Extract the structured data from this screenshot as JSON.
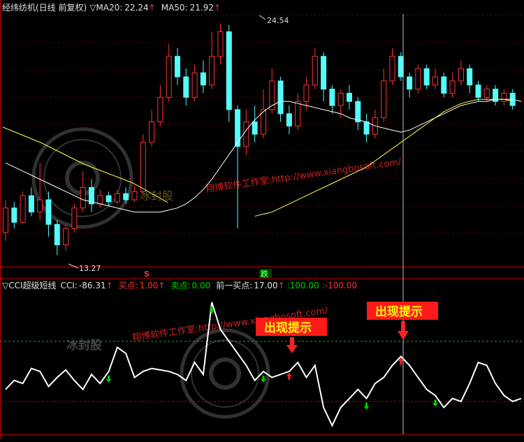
{
  "header": {
    "title": "经纬纺机(日线 前复权)",
    "ma20_label": "MA20:",
    "ma20_value": "22.24",
    "ma50_label": "MA50:",
    "ma50_value": "21.92"
  },
  "indicator_header": {
    "name": "CCI超级短线",
    "cci_label": "CCI:",
    "cci_value": "-86.31",
    "buy_label": "买点:",
    "buy_value": "1.00",
    "sell_label": "卖点:",
    "sell_value": "0.00",
    "prev_buy_label": "前一买点:",
    "prev_buy_value": "17.00",
    "upper_value": ":100.00",
    "lower_value": ":-100.00"
  },
  "price_labels": {
    "high": "24.54",
    "low": "13.27"
  },
  "axis_markers": {
    "s_marker": "S",
    "die_marker": "跌"
  },
  "annotations": {
    "tip1": "出现提示",
    "tip2": "出现提示"
  },
  "watermarks": {
    "studio_top": "翔博软件工作室:http://www.xiangbosoft.com/",
    "studio_bottom": "翔博软件工作室:http://www.xiangbosoft.com/",
    "brand_top": "冰封股",
    "brand_bottom": "冰封股"
  },
  "colors": {
    "up": "#ff3232",
    "down": "#54fcfc",
    "ma20": "#ffffff",
    "ma50": "#ffff50",
    "cci": "#ffffff",
    "level_upper": "#00c000",
    "level_lower": "#c00000",
    "buy_arrow": "#ff2020",
    "sell_arrow": "#00d000",
    "tip_bg": "#ff1a1a",
    "tip_text": "#ffff00"
  },
  "chart_data": [
    {
      "type": "candlestick",
      "ylim": [
        12.8,
        25.0
      ],
      "series": [
        {
          "name": "MA20",
          "values": [
            17.8,
            17.6,
            17.4,
            17.2,
            17.0,
            16.8,
            16.6,
            16.4,
            16.2,
            16.0,
            15.9,
            15.8,
            15.7,
            15.6,
            15.5,
            15.4,
            15.4,
            15.4,
            15.4,
            15.5,
            15.6,
            15.8,
            16.1,
            16.5,
            17.0,
            17.6,
            18.2,
            18.8,
            19.4,
            19.9,
            20.3,
            20.6,
            20.8,
            20.8,
            20.7,
            20.6,
            20.5,
            20.4,
            20.3,
            20.2,
            20.0,
            19.9,
            19.8,
            19.6,
            19.5,
            19.4,
            19.3,
            19.4,
            19.6,
            19.8,
            20.0,
            20.2,
            20.4,
            20.6,
            20.7,
            20.8,
            20.8,
            20.9,
            20.9,
            20.9,
            20.8
          ]
        },
        {
          "name": "MA50",
          "values": [
            15.2,
            15.3,
            15.4,
            15.6,
            15.8,
            16.0,
            16.2,
            16.4,
            16.6,
            16.8,
            17.0,
            17.2,
            17.4,
            17.6,
            17.9,
            18.2,
            18.5,
            18.8,
            19.1,
            19.4,
            19.7,
            20.0,
            20.3,
            20.5,
            20.7,
            20.8,
            20.9,
            20.9,
            20.9,
            20.9,
            20.8
          ]
        }
      ],
      "candles": [
        [
          14.4,
          15.6,
          16.0,
          14.0
        ],
        [
          15.6,
          14.9,
          15.9,
          14.6
        ],
        [
          14.9,
          16.2,
          16.4,
          14.8
        ],
        [
          16.2,
          15.4,
          16.6,
          15.2
        ],
        [
          15.4,
          16.0,
          17.8,
          15.0
        ],
        [
          16.0,
          14.8,
          16.4,
          14.2
        ],
        [
          14.8,
          13.8,
          15.0,
          13.3
        ],
        [
          13.8,
          14.6,
          14.8,
          13.5
        ],
        [
          14.6,
          15.6,
          15.8,
          14.4
        ],
        [
          15.6,
          16.6,
          17.4,
          15.4
        ],
        [
          16.6,
          15.8,
          17.0,
          15.4
        ],
        [
          15.8,
          16.2,
          16.5,
          15.6
        ],
        [
          16.2,
          15.9,
          16.4,
          15.7
        ],
        [
          15.9,
          16.3,
          16.5,
          15.8
        ],
        [
          16.3,
          16.0,
          16.6,
          15.8
        ],
        [
          16.0,
          16.4,
          16.7,
          15.9
        ],
        [
          16.4,
          18.8,
          19.2,
          16.2
        ],
        [
          18.8,
          19.8,
          20.4,
          18.6
        ],
        [
          19.8,
          21.0,
          21.6,
          19.6
        ],
        [
          21.0,
          23.0,
          23.6,
          20.8
        ],
        [
          23.0,
          22.0,
          23.4,
          21.6
        ],
        [
          22.0,
          21.0,
          22.4,
          20.6
        ],
        [
          21.0,
          22.2,
          22.6,
          20.8
        ],
        [
          22.2,
          21.6,
          22.8,
          21.2
        ],
        [
          21.6,
          23.0,
          24.2,
          21.4
        ],
        [
          23.0,
          24.2,
          24.6,
          22.6
        ],
        [
          24.2,
          20.4,
          24.54,
          19.8
        ],
        [
          20.4,
          18.6,
          20.6,
          14.6
        ],
        [
          18.6,
          19.8,
          20.4,
          18.2
        ],
        [
          19.8,
          19.2,
          20.6,
          18.8
        ],
        [
          19.2,
          20.4,
          21.4,
          19.0
        ],
        [
          20.4,
          21.8,
          22.4,
          20.2
        ],
        [
          21.8,
          20.2,
          22.0,
          19.8
        ],
        [
          20.2,
          19.6,
          20.6,
          19.2
        ],
        [
          19.6,
          20.8,
          21.2,
          19.4
        ],
        [
          20.8,
          21.6,
          22.0,
          20.4
        ],
        [
          21.6,
          23.0,
          23.4,
          21.4
        ],
        [
          23.0,
          21.4,
          23.2,
          20.8
        ],
        [
          21.4,
          20.6,
          21.6,
          20.2
        ],
        [
          20.6,
          21.2,
          21.4,
          20.0
        ],
        [
          21.2,
          20.8,
          21.6,
          20.4
        ],
        [
          20.8,
          19.8,
          21.0,
          19.4
        ],
        [
          19.8,
          19.2,
          20.2,
          18.8
        ],
        [
          19.2,
          20.0,
          20.4,
          19.0
        ],
        [
          20.0,
          21.8,
          22.4,
          19.8
        ],
        [
          21.8,
          23.0,
          23.4,
          21.6
        ],
        [
          23.0,
          22.0,
          23.2,
          21.8
        ],
        [
          22.0,
          21.4,
          22.2,
          21.0
        ],
        [
          21.4,
          22.4,
          22.6,
          21.2
        ],
        [
          22.4,
          21.6,
          22.6,
          21.4
        ],
        [
          21.6,
          22.0,
          22.4,
          21.4
        ],
        [
          22.0,
          21.2,
          22.2,
          21.0
        ],
        [
          21.2,
          21.8,
          22.2,
          21.0
        ],
        [
          21.8,
          22.4,
          22.8,
          21.6
        ],
        [
          22.4,
          21.6,
          22.6,
          21.2
        ],
        [
          21.6,
          21.0,
          21.8,
          20.8
        ],
        [
          21.0,
          21.4,
          21.6,
          20.8
        ],
        [
          21.4,
          20.8,
          21.6,
          20.6
        ],
        [
          20.8,
          21.2,
          21.4,
          20.6
        ],
        [
          21.2,
          20.6,
          21.4,
          20.4
        ]
      ]
    },
    {
      "type": "line",
      "series": [
        {
          "name": "CCI",
          "values": [
            -60,
            -30,
            -40,
            10,
            0,
            -50,
            -20,
            5,
            -30,
            -60,
            -10,
            -40,
            0,
            80,
            60,
            -20,
            0,
            10,
            5,
            0,
            -10,
            -30,
            30,
            -10,
            230,
            140,
            100,
            60,
            20,
            -30,
            0,
            -20,
            -10,
            0,
            30,
            -20,
            20,
            -120,
            -180,
            -120,
            -90,
            -60,
            -90,
            -40,
            -20,
            20,
            50,
            20,
            -20,
            -60,
            -80,
            -120,
            -90,
            -100,
            -40,
            30,
            20,
            -40,
            -80,
            -100,
            -90
          ]
        }
      ],
      "levels": {
        "upper": 100,
        "lower": -100
      },
      "ylim": [
        -200,
        260
      ]
    }
  ]
}
